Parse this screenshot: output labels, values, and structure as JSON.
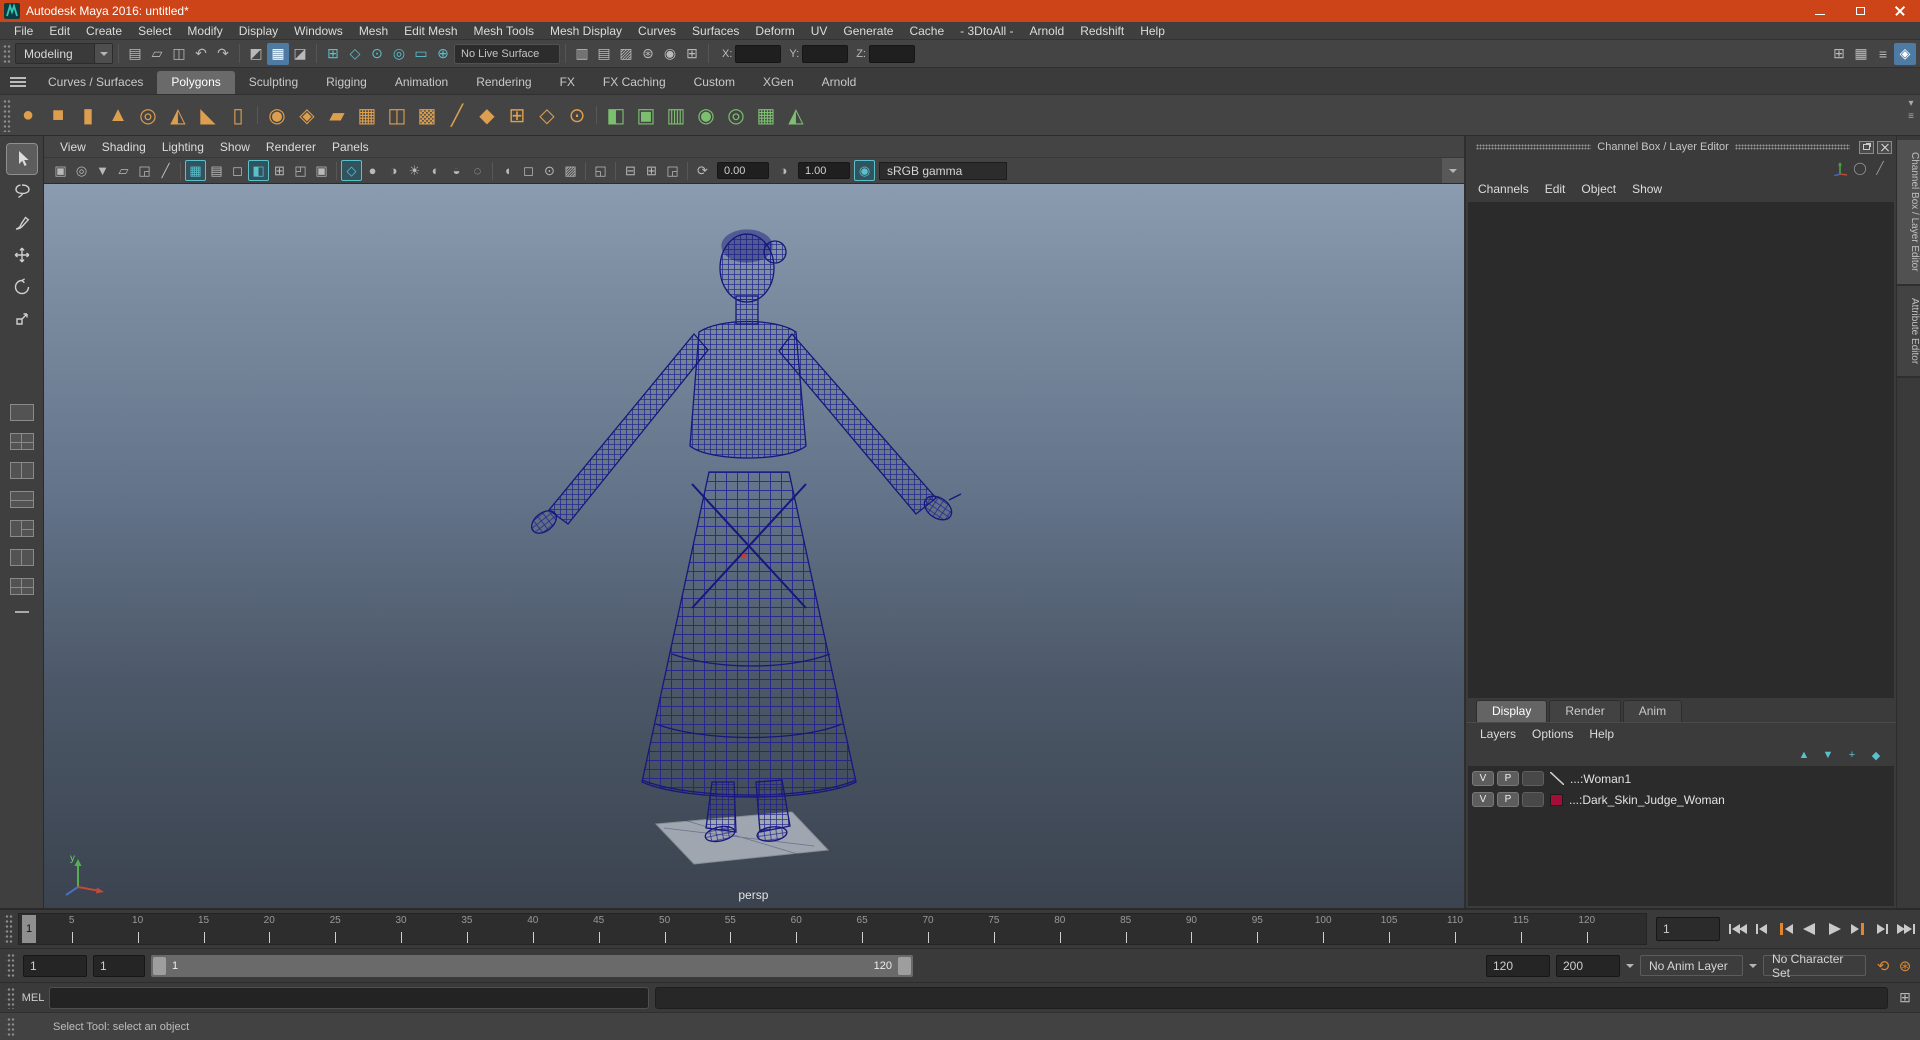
{
  "colors": {
    "titlebar": "#cc4418",
    "accent_teal": "#5bc0cc",
    "accent_blue": "#4d7ba3",
    "shelf_orange": "#dd9e4e",
    "wireframe": "#1c1c96",
    "swatch_red": "#a30d37"
  },
  "titlebar": {
    "title": "Autodesk Maya 2016: untitled*"
  },
  "menubar": {
    "items": [
      "File",
      "Edit",
      "Create",
      "Select",
      "Modify",
      "Display",
      "Windows",
      "Mesh",
      "Edit Mesh",
      "Mesh Tools",
      "Mesh Display",
      "Curves",
      "Surfaces",
      "Deform",
      "UV",
      "Generate",
      "Cache",
      "- 3DtoAll -",
      "Arnold",
      "Redshift",
      "Help"
    ]
  },
  "statusline": {
    "menuset": "Modeling",
    "file_icons": [
      "new-scene-icon",
      "open-scene-icon",
      "save-scene-icon",
      "undo-icon",
      "redo-icon"
    ],
    "selection_icons": [
      "select-hierarchy-icon",
      {
        "name": "select-object-icon",
        "active": true
      },
      "select-component-icon"
    ],
    "snap_icons": [
      "snap-grid-icon",
      "snap-curve-icon",
      "snap-point-icon",
      "snap-projected-center-icon",
      "snap-view-plane-icon",
      "make-live-icon"
    ],
    "live_surface": "No Live Surface",
    "render_icons": [
      "render-view-icon",
      "render-frame-icon",
      "ipr-render-icon",
      "render-settings-icon",
      "light-editor-icon",
      "symmetry-icon"
    ],
    "inputs": {
      "x_label": "X:",
      "x_value": "",
      "y_label": "Y:",
      "y_value": "",
      "z_label": "Z:",
      "z_value": ""
    },
    "workspace_icons": [
      "workspace-classic-icon",
      "workspace-panels-icon",
      "workspace-sliders-icon",
      {
        "name": "workspace-arnold-icon",
        "active": true
      }
    ]
  },
  "shelf": {
    "tabs": [
      {
        "label": "Curves / Surfaces"
      },
      {
        "label": "Polygons",
        "active": true
      },
      {
        "label": "Sculpting"
      },
      {
        "label": "Rigging"
      },
      {
        "label": "Animation"
      },
      {
        "label": "Rendering"
      },
      {
        "label": "FX"
      },
      {
        "label": "FX Caching"
      },
      {
        "label": "Custom"
      },
      {
        "label": "XGen"
      },
      {
        "label": "Arnold"
      }
    ],
    "icons": [
      "poly-sphere-icon",
      "poly-cube-icon",
      "poly-cylinder-icon",
      "poly-cone-icon",
      "poly-torus-icon",
      "poly-pyramid-icon",
      "poly-prism-icon",
      "poly-pipe-icon",
      "|",
      "sphere-projection-icon",
      "cube-projection-icon",
      "planar-projection-icon",
      "grid-fill-icon",
      "poly-count-icon",
      "subdiv-display-icon",
      "multi-cut-icon",
      "bevel-icon",
      "extrude-icon",
      "quad-draw-icon",
      "target-weld-icon",
      "|",
      {
        "name": "mirror-icon",
        "color": "green"
      },
      {
        "name": "combine-icon",
        "color": "green"
      },
      {
        "name": "separate-icon",
        "color": "green"
      },
      {
        "name": "boolean-union-icon",
        "color": "green"
      },
      {
        "name": "boolean-difference-icon",
        "color": "green"
      },
      {
        "name": "uv-checker-icon",
        "color": "green"
      },
      {
        "name": "sculpt-icon",
        "color": "green"
      }
    ],
    "corner_icons": [
      "shelf-menu-icon",
      "shelf-list-icon"
    ]
  },
  "toolbox": {
    "tools": [
      {
        "name": "select-tool",
        "active": true
      },
      {
        "name": "lasso-tool"
      },
      {
        "name": "paint-select-tool"
      },
      {
        "name": "move-tool"
      },
      {
        "name": "rotate-tool"
      },
      {
        "name": "scale-tool"
      }
    ],
    "layouts": [
      "single-pane-layout",
      "four-pane-layout",
      "persp-outliner-layout",
      "top-persp-layout",
      "persp-graph-layout",
      "outliner-persp-layout",
      "hypershade-persp-layout"
    ]
  },
  "viewport": {
    "menus": [
      "View",
      "Shading",
      "Lighting",
      "Show",
      "Renderer",
      "Panels"
    ],
    "toolbar_icons": [
      "camera-icon",
      "camera-attributes-icon",
      "bookmark-icon",
      "image-plane-icon",
      "2d-pan-zoom-icon",
      "grease-pencil-icon",
      "|",
      {
        "name": "grid-toggle-icon",
        "active": true
      },
      "film-gate-icon",
      "resolution-gate-icon",
      {
        "name": "gate-mask-icon",
        "active": true
      },
      "field-chart-icon",
      "safe-action-icon",
      "safe-title-icon",
      "|",
      {
        "name": "wireframe-mode-icon",
        "active": true
      },
      "shaded-mode-icon",
      "textured-mode-icon",
      "all-lights-icon",
      "shadows-icon",
      "ao-icon",
      "motion-blur-icon",
      "|",
      "isolate-select-icon",
      "xray-icon",
      "xray-joints-icon",
      "fog-icon",
      "|",
      "select-highlight-icon",
      "|",
      "pane-split-icon",
      "pane-split2-icon",
      "region-tool-icon",
      "|",
      "exposure-icon"
    ],
    "contrast_icons": [
      "contrast-icon"
    ],
    "cm_icons": [
      {
        "name": "color-managed-icon",
        "active": true
      }
    ],
    "exposure_value": "0.00",
    "contrast_value": "1.00",
    "color_space": "sRGB gamma",
    "camera_label": "persp",
    "axis_label": "y"
  },
  "channel_box": {
    "title": "Channel Box / Layer Editor",
    "corner_icons": [
      "axis-tool-icon",
      "render-sphere-icon",
      "pencil-icon"
    ],
    "menus": [
      "Channels",
      "Edit",
      "Object",
      "Show"
    ],
    "layer_editor": {
      "tabs": [
        {
          "label": "Display",
          "active": true
        },
        {
          "label": "Render"
        },
        {
          "label": "Anim"
        }
      ],
      "menus": [
        "Layers",
        "Options",
        "Help"
      ],
      "icons": [
        "move-layer-up-icon",
        "move-layer-down-icon",
        "add-empty-layer-icon",
        "add-layer-icon"
      ],
      "layers": [
        {
          "visibility": "V",
          "playback": "P",
          "type": "reference-layer-icon",
          "name": "...:Woman1"
        },
        {
          "visibility": "V",
          "playback": "P",
          "type": "color-swatch",
          "color": "#a30d37",
          "name": "...:Dark_Skin_Judge_Woman"
        }
      ]
    }
  },
  "side_tabs": [
    {
      "label": "Channel Box / Layer Editor",
      "active": true
    },
    {
      "label": "Attribute Editor"
    }
  ],
  "timeline": {
    "ticks": [
      5,
      10,
      15,
      20,
      25,
      30,
      35,
      40,
      45,
      50,
      55,
      60,
      65,
      70,
      75,
      80,
      85,
      90,
      95,
      100,
      105,
      110,
      115,
      120
    ],
    "current_frame": "1",
    "frame_field_value": "1",
    "playback_buttons": [
      "go-to-start",
      "step-back-frame",
      "step-back-key",
      "play-backwards",
      "play-forwards",
      "step-forward-key",
      "step-forward-frame",
      "go-to-end"
    ]
  },
  "range": {
    "anim_start": "1",
    "playback_start": "1",
    "range_start_label": "1",
    "range_end_label": "120",
    "playback_end": "120",
    "anim_end": "200",
    "anim_layer": "No Anim Layer",
    "character_set": "No Character Set",
    "icons": [
      "auto-key-icon",
      "anim-prefs-icon"
    ]
  },
  "command_line": {
    "label": "MEL",
    "input_value": ""
  },
  "help_line": {
    "text": "Select Tool: select an object"
  }
}
